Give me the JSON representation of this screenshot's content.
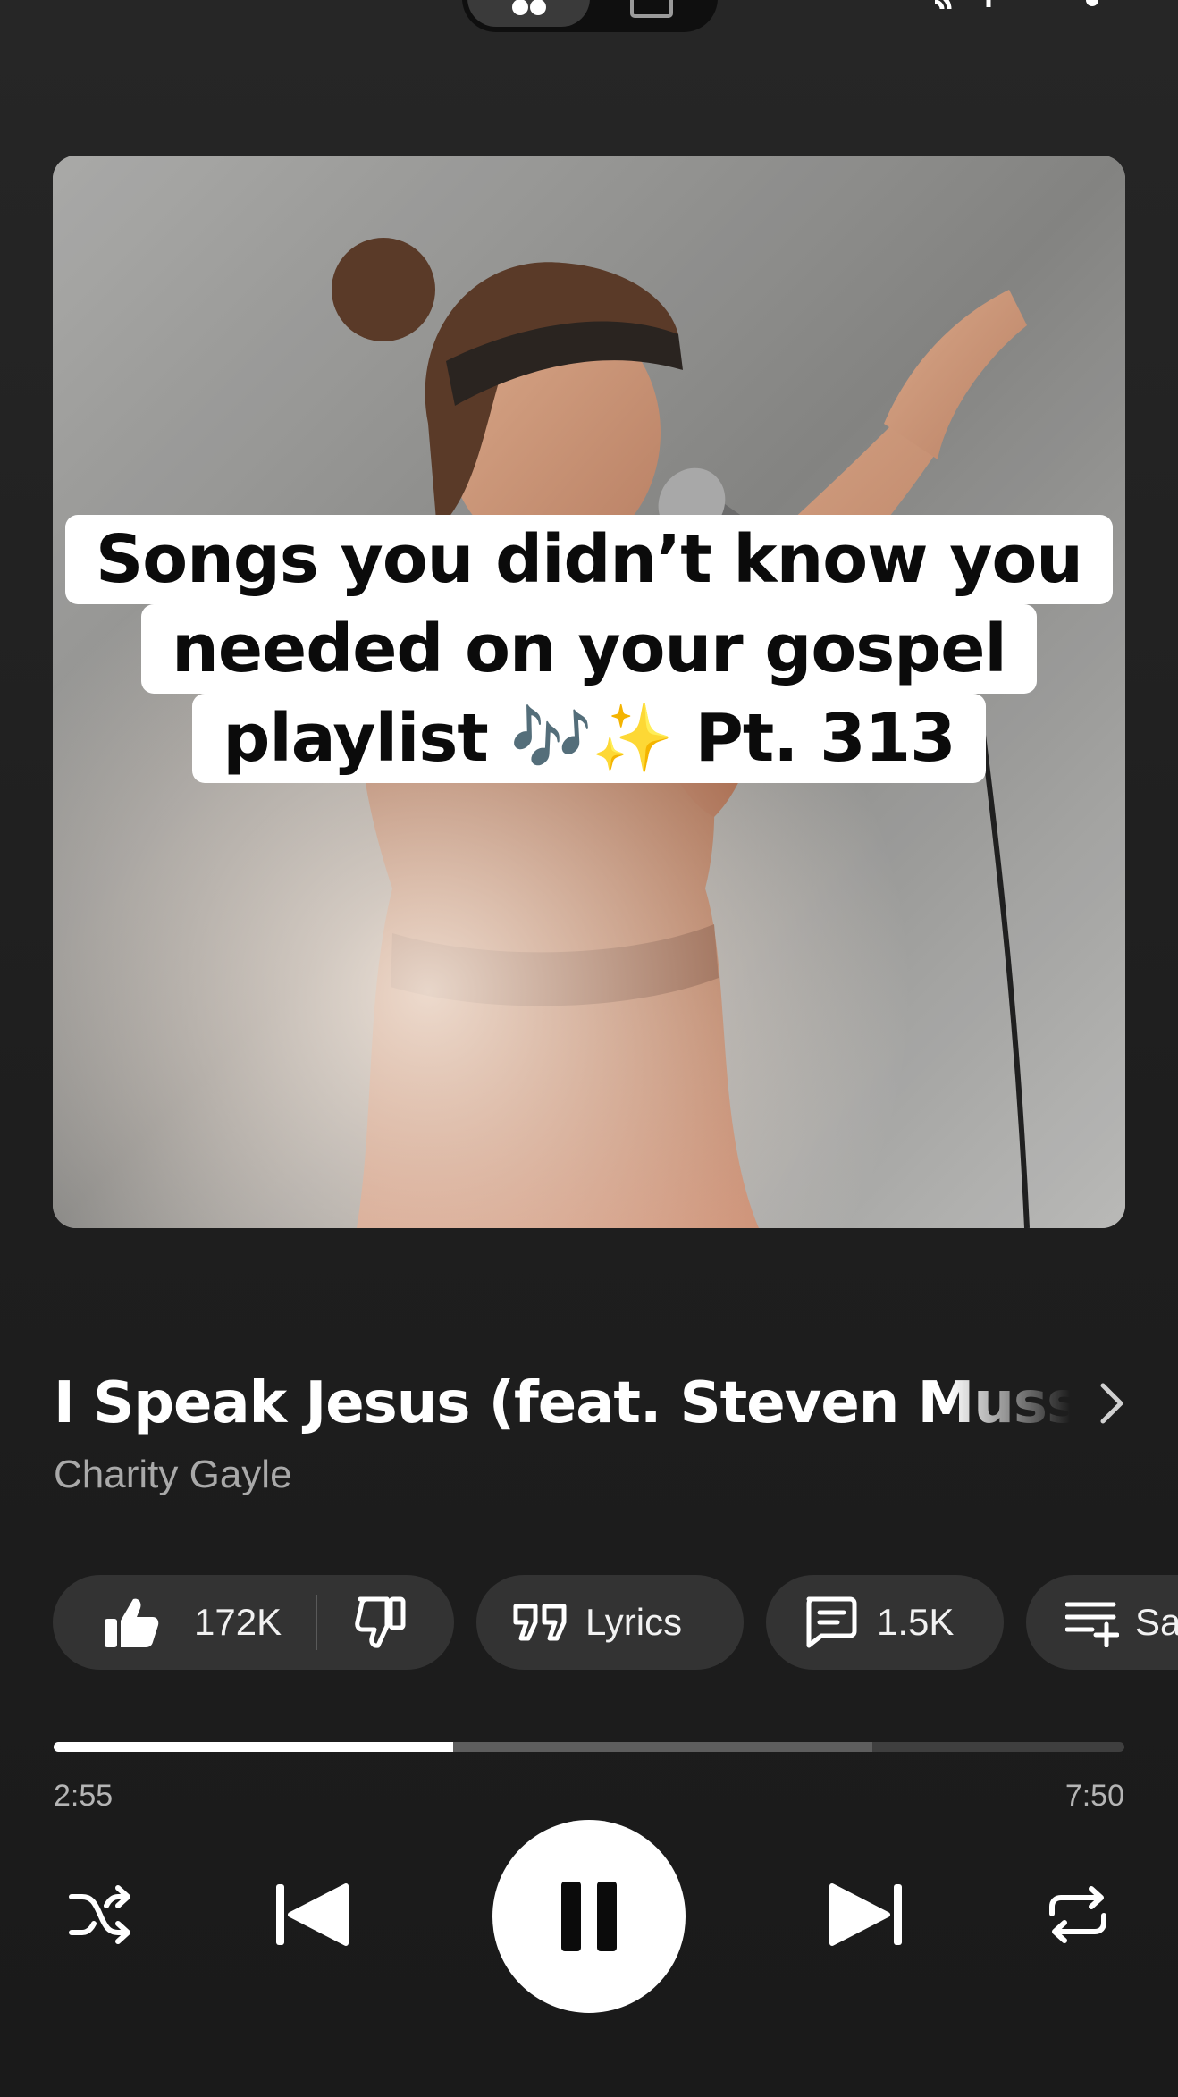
{
  "artwork": {
    "caption_lines": [
      "Songs you didn’t know you",
      "needed on your gospel",
      "playlist 🎶✨ Pt. 313"
    ]
  },
  "track": {
    "title": "I Speak Jesus (feat. Steven Musso)",
    "artist": "Charity Gayle"
  },
  "actions": {
    "likes": "172K",
    "lyrics_label": "Lyrics",
    "comments": "1.5K",
    "save_label": "Save"
  },
  "playback": {
    "elapsed": "2:55",
    "total": "7:50",
    "progress_fraction": 0.373,
    "buffered_fraction": 0.765,
    "state": "playing"
  },
  "icons": {
    "top": [
      "song-toggle-icon",
      "video-toggle-icon",
      "cast-icon",
      "more-icon"
    ],
    "controls": [
      "shuffle-icon",
      "previous-icon",
      "pause-icon",
      "next-icon",
      "repeat-icon"
    ]
  },
  "colors": {
    "background": "#1f1f1f",
    "chip": "#333333",
    "accent": "#ffffff",
    "secondary_text": "#a9a9a9"
  }
}
